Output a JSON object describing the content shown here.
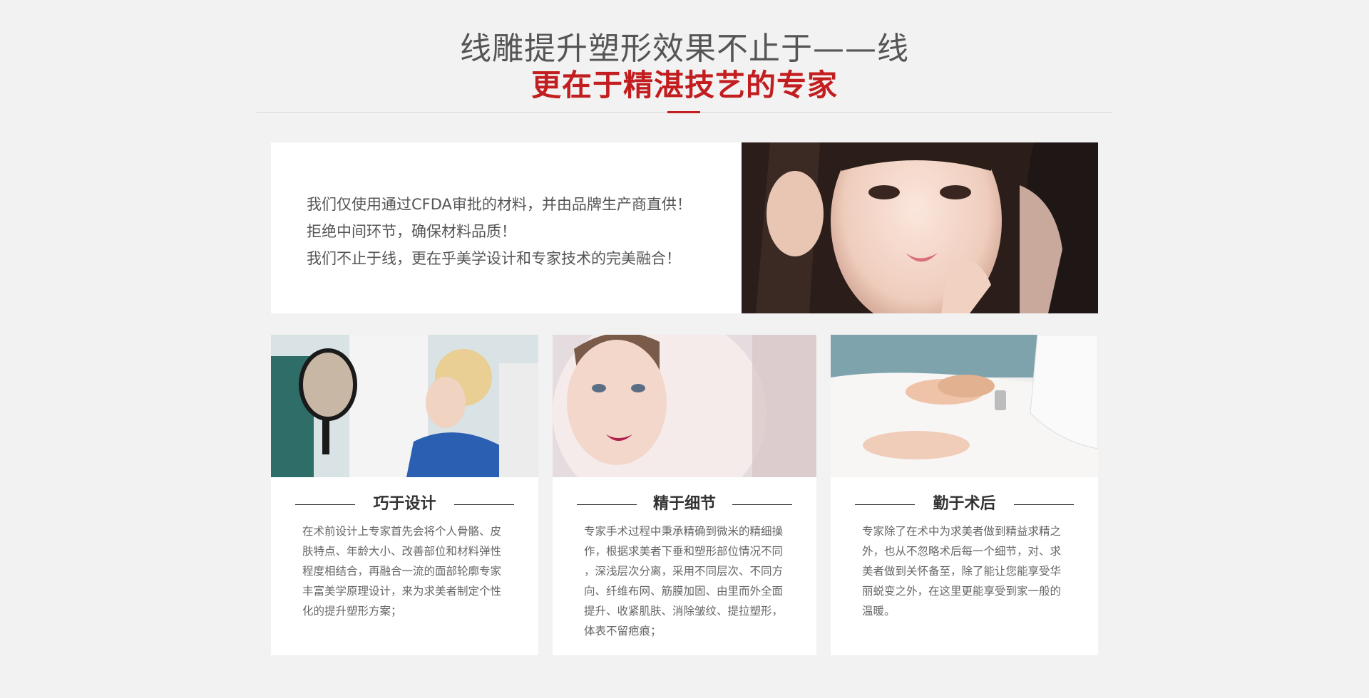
{
  "header": {
    "line1": "线雕提升塑形效果不止于——线",
    "line2": "更在于精湛技艺的专家"
  },
  "intro": {
    "lines": [
      "我们仅使用通过CFDA审批的材料，并由品牌生产商直供！",
      "拒绝中间环节，确保材料品质！",
      "我们不止于线，更在乎美学设计和专家技术的完美融合！"
    ],
    "photo": "woman-face-portrait"
  },
  "cards": [
    {
      "title": "巧于设计",
      "photo": "doctor-patient-mirror",
      "lines": [
        "在术前设计上专家首先会将个人骨骼、皮",
        "肤特点、年龄大小、改善部位和材料弹性",
        "程度相结合，再融合一流的面部轮廓专家",
        "丰富美学原理设计，来为求美者制定个性",
        "化的提升塑形方案；"
      ]
    },
    {
      "title": "精于细节",
      "photo": "woman-mirror-reflection",
      "lines": [
        "专家手术过程中秉承精确到微米的精细操",
        "作，根据求美者下垂和塑形部位情况不同",
        "，深浅层次分离，采用不同层次、不同方",
        "向、纤维布网、筋膜加固、由里而外全面",
        "提升、收紧肌肤、消除皱纹、提拉塑形，",
        "体表不留疤痕；"
      ]
    },
    {
      "title": "勤于术后",
      "photo": "caring-hands",
      "lines": [
        "专家除了在术中为求美者做到精益求精之",
        "外，也从不忽略术后每一个细节，对、求",
        "美者做到关怀备至，除了能让您能享受华",
        "丽蜕变之外，在这里更能享受到家一般的",
        "温暖。"
      ]
    }
  ]
}
